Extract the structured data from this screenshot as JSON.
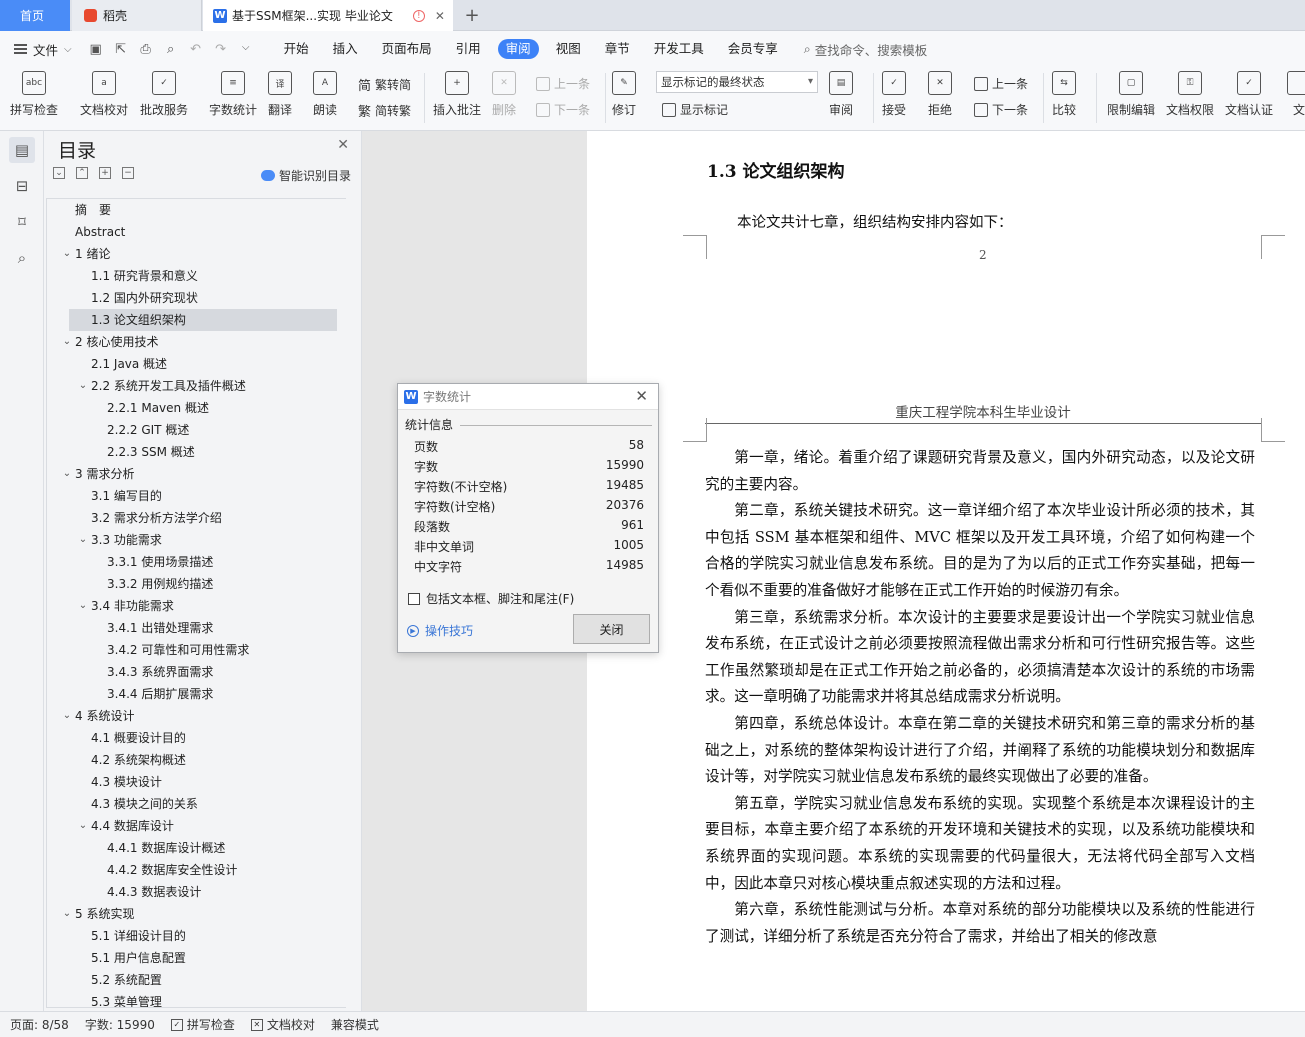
{
  "tabs": {
    "home": "首页",
    "daoke": "稻壳",
    "document": "基于SSM框架...实现 毕业论文"
  },
  "menu": {
    "file": "文件",
    "items": [
      "开始",
      "插入",
      "页面布局",
      "引用",
      "审阅",
      "视图",
      "章节",
      "开发工具",
      "会员专享"
    ],
    "active": "审阅",
    "search": "查找命令、搜索模板"
  },
  "ribbon": {
    "spell": "拼写检查",
    "doc_check": "文档校对",
    "batch": "批改服务",
    "word_count": "字数统计",
    "translate": "翻译",
    "read": "朗读",
    "to_trad": "繁转简",
    "to_simp": "简转繁",
    "insert_comment": "插入批注",
    "delete": "删除",
    "prev": "上一条",
    "next": "下一条",
    "revise": "修订",
    "display_state": "显示标记的最终状态",
    "show_marks": "显示标记",
    "review": "审阅",
    "accept": "接受",
    "reject": "拒绝",
    "prev2": "上一条",
    "next2": "下一条",
    "compare": "比较",
    "restrict": "限制编辑",
    "permission": "文档权限",
    "certify": "文档认证",
    "cut": "文"
  },
  "toc": {
    "title": "目录",
    "smart": "智能识别目录",
    "items": [
      {
        "label": "摘　要",
        "level": 0
      },
      {
        "label": "Abstract",
        "level": 0
      },
      {
        "label": "1  绪论",
        "level": 0,
        "toggle": true
      },
      {
        "label": "1.1  研究背景和意义",
        "level": 1
      },
      {
        "label": "1.2  国内外研究现状",
        "level": 1
      },
      {
        "label": "1.3  论文组织架构",
        "level": 1,
        "selected": true
      },
      {
        "label": "2  核心使用技术",
        "level": 0,
        "toggle": true
      },
      {
        "label": "2.1 Java 概述",
        "level": 1
      },
      {
        "label": "2.2 系统开发工具及插件概述",
        "level": 1,
        "toggle": true
      },
      {
        "label": "2.2.1 Maven  概述",
        "level": 2
      },
      {
        "label": "2.2.2 GIT 概述",
        "level": 2
      },
      {
        "label": "2.2.3 SSM 概述",
        "level": 2
      },
      {
        "label": "3  需求分析",
        "level": 0,
        "toggle": true
      },
      {
        "label": "3.1  编写目的",
        "level": 1
      },
      {
        "label": "3.2  需求分析方法学介绍",
        "level": 1
      },
      {
        "label": "3.3 功能需求",
        "level": 1,
        "toggle": true
      },
      {
        "label": "3.3.1 使用场景描述",
        "level": 2
      },
      {
        "label": "3.3.2 用例规约描述",
        "level": 2
      },
      {
        "label": "3.4  非功能需求",
        "level": 1,
        "toggle": true
      },
      {
        "label": "3.4.1  出错处理需求",
        "level": 2
      },
      {
        "label": "3.4.2  可靠性和可用性需求",
        "level": 2
      },
      {
        "label": "3.4.3  系统界面需求",
        "level": 2
      },
      {
        "label": "3.4.4  后期扩展需求",
        "level": 2
      },
      {
        "label": "4  系统设计",
        "level": 0,
        "toggle": true
      },
      {
        "label": "4.1  概要设计目的",
        "level": 1
      },
      {
        "label": "4.2  系统架构概述",
        "level": 1
      },
      {
        "label": "4.3  模块设计",
        "level": 1
      },
      {
        "label": "4.3  模块之间的关系",
        "level": 1
      },
      {
        "label": "4.4  数据库设计",
        "level": 1,
        "toggle": true
      },
      {
        "label": "4.4.1  数据库设计概述",
        "level": 2
      },
      {
        "label": "4.4.2  数据库安全性设计",
        "level": 2
      },
      {
        "label": "4.4.3 数据表设计",
        "level": 2
      },
      {
        "label": "5  系统实现",
        "level": 0,
        "toggle": true
      },
      {
        "label": "5.1  详细设计目的",
        "level": 1
      },
      {
        "label": "5.1  用户信息配置",
        "level": 1
      },
      {
        "label": "5.2  系统配置",
        "level": 1
      },
      {
        "label": "5.3  菜单管理",
        "level": 1
      }
    ]
  },
  "document": {
    "heading": "1.3  论文组织架构",
    "intro": "本论文共计七章，组织结构安排内容如下：",
    "page_number": "2",
    "header": "重庆工程学院本科生毕业设计",
    "paragraphs": [
      "第一章，绪论。着重介绍了课题研究背景及意义，国内外研究动态，以及论文研究的主要内容。",
      "第二章，系统关键技术研究。这一章详细介绍了本次毕业设计所必须的技术，其中包括 SSM 基本框架和组件、MVC 框架以及开发工具环境，介绍了如何构建一个合格的学院实习就业信息发布系统。目的是为了为以后的正式工作夯实基础，把每一个看似不重要的准备做好才能够在正式工作开始的时候游刃有余。",
      "第三章，系统需求分析。本次设计的主要要求是要设计出一个学院实习就业信息发布系统，在正式设计之前必须要按照流程做出需求分析和可行性研究报告等。这些工作虽然繁琐却是在正式工作开始之前必备的，必须搞清楚本次设计的系统的市场需求。这一章明确了功能需求并将其总结成需求分析说明。",
      "第四章，系统总体设计。本章在第二章的关键技术研究和第三章的需求分析的基础之上，对系统的整体架构设计进行了介绍，并阐释了系统的功能模块划分和数据库设计等，对学院实习就业信息发布系统的最终实现做出了必要的准备。",
      "第五章，学院实习就业信息发布系统的实现。实现整个系统是本次课程设计的主要目标，本章主要介绍了本系统的开发环境和关键技术的实现，以及系统功能模块和系统界面的实现问题。本系统的实现需要的代码量很大，无法将代码全部写入文档中，因此本章只对核心模块重点叙述实现的方法和过程。",
      "第六章，系统性能测试与分析。本章对系统的部分功能模块以及系统的性能进行了测试，详细分析了系统是否充分符合了需求，并给出了相关的修改意"
    ]
  },
  "dialog": {
    "title": "字数统计",
    "section": "统计信息",
    "stats": [
      {
        "label": "页数",
        "value": "58"
      },
      {
        "label": "字数",
        "value": "15990"
      },
      {
        "label": "字符数(不计空格)",
        "value": "19485"
      },
      {
        "label": "字符数(计空格)",
        "value": "20376"
      },
      {
        "label": "段落数",
        "value": "961"
      },
      {
        "label": "非中文单词",
        "value": "1005"
      },
      {
        "label": "中文字符",
        "value": "14985"
      }
    ],
    "checkbox": "包括文本框、脚注和尾注(F)",
    "tips": "操作技巧",
    "close": "关闭"
  },
  "status": {
    "page": "页面: 8/58",
    "words": "字数: 15990",
    "spell": "拼写检查",
    "doc_check": "文档校对",
    "compat": "兼容模式"
  },
  "colors": {
    "accent": "#3d82f7",
    "home_tab": "#4a8cf7",
    "link": "#3a76d6"
  }
}
